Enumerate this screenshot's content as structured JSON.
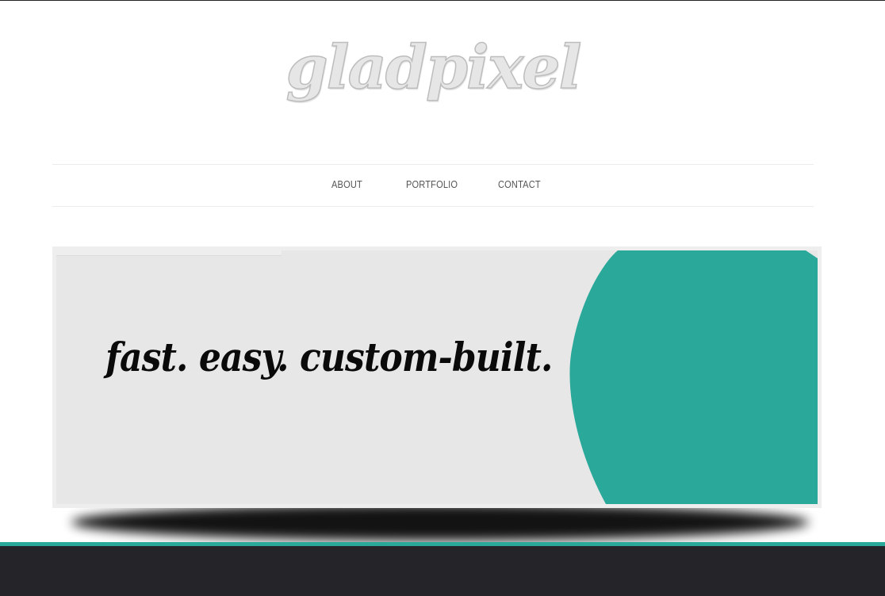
{
  "header": {
    "logo_text": "gladpixel"
  },
  "nav": {
    "items": [
      {
        "label": "ABOUT"
      },
      {
        "label": "PORTFOLIO"
      },
      {
        "label": "CONTACT"
      }
    ]
  },
  "hero": {
    "tagline": "fast. easy. custom-built.",
    "slider_progress": 0.3
  },
  "colors": {
    "accent": "#2aa89a",
    "banner_background": "#e7e7e7",
    "footer": "#252429",
    "logo_fill": "#e6e6e6"
  }
}
